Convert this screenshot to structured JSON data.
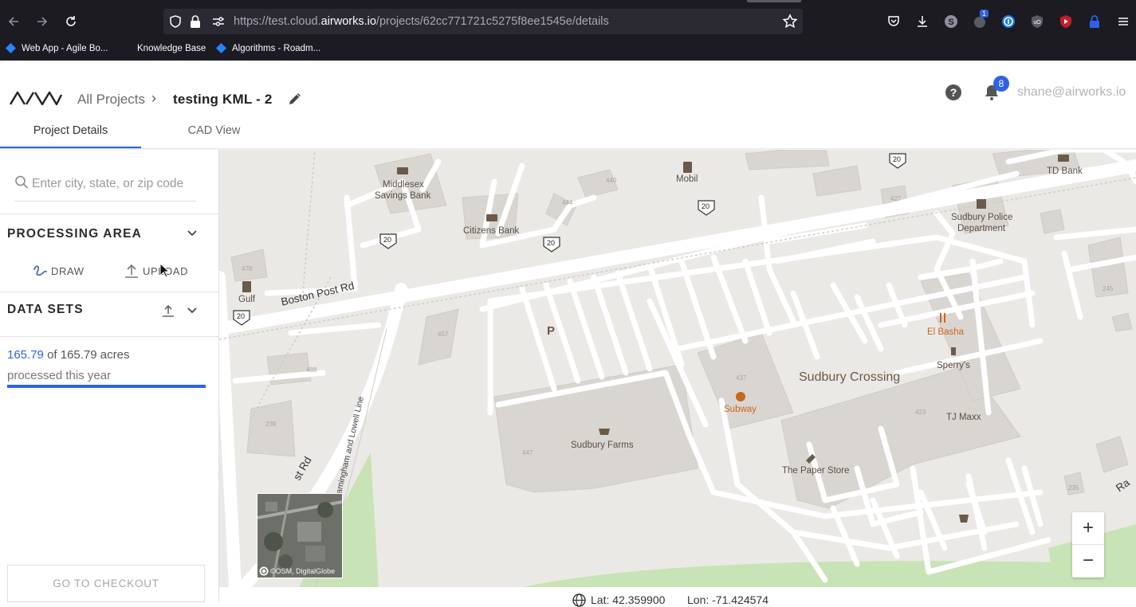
{
  "browser": {
    "url_prefix": "https://test.cloud.",
    "url_domain": "airworks.io",
    "url_path": "/projects/62cc771721c5275f8ee1545e/details",
    "extension_badge": "1",
    "bookmarks": [
      {
        "label": "Web App - Agile Bo..."
      },
      {
        "label": "Knowledge Base"
      },
      {
        "label": "Algorithms - Roadm..."
      }
    ]
  },
  "header": {
    "breadcrumb_all": "All Projects",
    "breadcrumb_sep": "›",
    "project_name": "testing KML - 2",
    "notification_count": "8",
    "user_email": "shane@airworks.io",
    "tabs": [
      {
        "label": "Project Details"
      },
      {
        "label": "CAD View"
      }
    ]
  },
  "sidebar": {
    "search_placeholder": "Enter city, state, or zip code",
    "processing_area_title": "PROCESSING AREA",
    "draw_label": "DRAW",
    "upload_label": "UPLOAD",
    "data_sets_title": "DATA SETS",
    "acres_used": "165.79",
    "acres_total_text": "of 165.79 acres",
    "acres_caption": "processed this year",
    "progress_fraction": 1.0,
    "checkout_label": "GO TO CHECKOUT"
  },
  "map": {
    "labels": {
      "middlesex": "Middlesex",
      "savings_bank": "Savings Bank",
      "citizens_bank": "Citizens Bank",
      "mobil": "Mobil",
      "td_bank": "TD Bank",
      "sudbury_police": "Sudbury Police",
      "department": "Department",
      "gulf": "Gulf",
      "boston_post_rd": "Boston Post Rd",
      "boston_post_rd_partial": "st Rd",
      "framingham_lowell": "Framingham and Lowell Line",
      "el_basha": "El Basha",
      "sperrys": "Sperry's",
      "sudbury_crossing": "Sudbury Crossing",
      "subway": "Subway",
      "tj_maxx": "TJ Maxx",
      "sudbury_farms": "Sudbury Farms",
      "paper_store": "The Paper Store",
      "parking": "P",
      "route": "20",
      "edge_label": "Ra",
      "num_440": "440",
      "num_444": "444",
      "num_427": "427",
      "num_478": "478",
      "num_457": "457",
      "num_488": "488",
      "num_437": "437",
      "num_423": "423",
      "num_447": "447",
      "num_239": "239",
      "num_245": "245",
      "num_235": "235"
    },
    "minimap_attribution": "©OSM, DigitalGlobe",
    "zoom_in": "+",
    "zoom_out": "−",
    "lat_text": "Lat: 42.359900",
    "lon_text": "Lon: -71.424574"
  },
  "colors": {
    "accent": "#2d62e8",
    "map_background": "#ebe9e6",
    "road": "#ffffff",
    "building": "#d9d6d2",
    "park": "#c8e3b5",
    "orange_poi": "#c9661d"
  }
}
